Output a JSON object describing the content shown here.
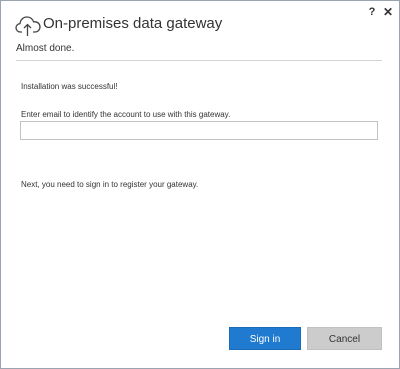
{
  "window": {
    "title": "On-premises data gateway",
    "logo_icon": "cloud-upload-icon",
    "help_label": "?",
    "close_label": "✕"
  },
  "page": {
    "subtitle": "Almost done.",
    "status": "Installation was successful!",
    "email_label": "Enter email to identify the account to use with this gateway.",
    "email_value": "",
    "email_placeholder": "",
    "next_step": "Next, you need to sign in to register your gateway."
  },
  "buttons": {
    "sign_in": "Sign in",
    "cancel": "Cancel"
  },
  "colors": {
    "accent": "#1f7ad0",
    "cancel_bg": "#cccccc",
    "divider": "#d4d4d4"
  }
}
